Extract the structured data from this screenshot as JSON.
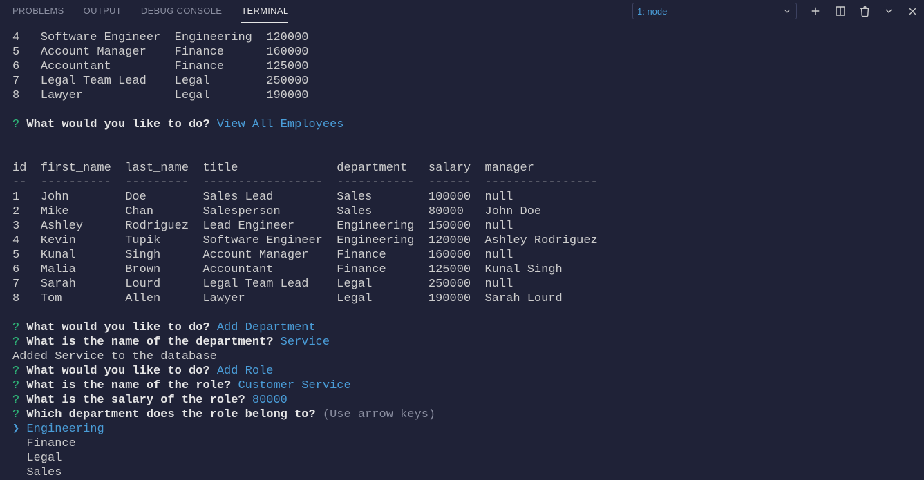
{
  "tabs": {
    "problems": "PROBLEMS",
    "output": "OUTPUT",
    "debug": "DEBUG CONSOLE",
    "terminal": "TERMINAL"
  },
  "term_select": "1: node",
  "roles_table": {
    "rows": [
      {
        "id": "4",
        "title": "Software Engineer",
        "dept": "Engineering",
        "salary": "120000"
      },
      {
        "id": "5",
        "title": "Account Manager",
        "dept": "Finance",
        "salary": "160000"
      },
      {
        "id": "6",
        "title": "Accountant",
        "dept": "Finance",
        "salary": "125000"
      },
      {
        "id": "7",
        "title": "Legal Team Lead",
        "dept": "Legal",
        "salary": "250000"
      },
      {
        "id": "8",
        "title": "Lawyer",
        "dept": "Legal",
        "salary": "190000"
      }
    ]
  },
  "prompt_main": "What would you like to do?",
  "answer_view_all": "View All Employees",
  "emp_table": {
    "headers": {
      "id": "id",
      "first": "first_name",
      "last": "last_name",
      "title": "title",
      "dept": "department",
      "salary": "salary",
      "manager": "manager"
    },
    "rows": [
      {
        "id": "1",
        "first": "John",
        "last": "Doe",
        "title": "Sales Lead",
        "dept": "Sales",
        "salary": "100000",
        "manager": "null"
      },
      {
        "id": "2",
        "first": "Mike",
        "last": "Chan",
        "title": "Salesperson",
        "dept": "Sales",
        "salary": "80000",
        "manager": "John Doe"
      },
      {
        "id": "3",
        "first": "Ashley",
        "last": "Rodriguez",
        "title": "Lead Engineer",
        "dept": "Engineering",
        "salary": "150000",
        "manager": "null"
      },
      {
        "id": "4",
        "first": "Kevin",
        "last": "Tupik",
        "title": "Software Engineer",
        "dept": "Engineering",
        "salary": "120000",
        "manager": "Ashley Rodriguez"
      },
      {
        "id": "5",
        "first": "Kunal",
        "last": "Singh",
        "title": "Account Manager",
        "dept": "Finance",
        "salary": "160000",
        "manager": "null"
      },
      {
        "id": "6",
        "first": "Malia",
        "last": "Brown",
        "title": "Accountant",
        "dept": "Finance",
        "salary": "125000",
        "manager": "Kunal Singh"
      },
      {
        "id": "7",
        "first": "Sarah",
        "last": "Lourd",
        "title": "Legal Team Lead",
        "dept": "Legal",
        "salary": "250000",
        "manager": "null"
      },
      {
        "id": "8",
        "first": "Tom",
        "last": "Allen",
        "title": "Lawyer",
        "dept": "Legal",
        "salary": "190000",
        "manager": "Sarah Lourd"
      }
    ]
  },
  "answer_add_dept": "Add Department",
  "prompt_dept_name": "What is the name of the department?",
  "answer_dept_name": "Service",
  "msg_added": "Added Service to the database",
  "answer_add_role": "Add Role",
  "prompt_role_name": "What is the name of the role?",
  "answer_role_name": "Customer Service",
  "prompt_role_salary": "What is the salary of the role?",
  "answer_role_salary": "80000",
  "prompt_role_dept": "Which department does the role belong to?",
  "hint_arrows": "(Use arrow keys)",
  "dept_choices": {
    "0": "Engineering",
    "1": "Finance",
    "2": "Legal",
    "3": "Sales"
  }
}
